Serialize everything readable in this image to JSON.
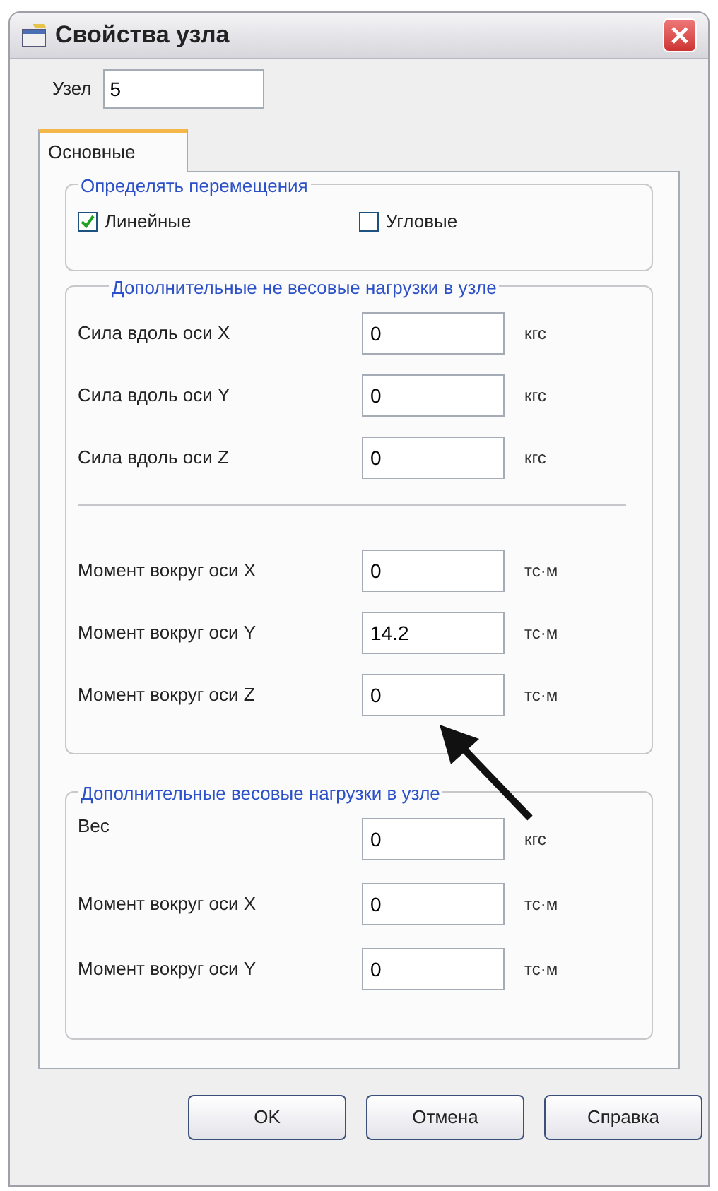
{
  "window": {
    "title": "Свойства узла"
  },
  "node": {
    "label": "Узел",
    "value": "5"
  },
  "tabs": [
    {
      "label": "Основные",
      "selected": true
    }
  ],
  "displacements": {
    "title": "Определять перемещения",
    "options": [
      {
        "label": "Линейные",
        "checked": true
      },
      {
        "label": "Угловые",
        "checked": false
      }
    ]
  },
  "non_weight_loads": {
    "title": "Дополнительные не весовые нагрузки в узле",
    "rows": [
      {
        "kind": "field",
        "label": "Сила вдоль оси X",
        "value": "0",
        "unit": "кгс"
      },
      {
        "kind": "field",
        "label": "Сила вдоль оси Y",
        "value": "0",
        "unit": "кгс"
      },
      {
        "kind": "field",
        "label": "Сила вдоль оси Z",
        "value": "0",
        "unit": "кгс"
      },
      {
        "kind": "separator"
      },
      {
        "kind": "field",
        "label": "Момент вокруг оси X",
        "value": "0",
        "unit": "тс·м"
      },
      {
        "kind": "field",
        "label": "Момент вокруг оси Y",
        "value": "14.2",
        "unit": "тс·м"
      },
      {
        "kind": "field",
        "label": "Момент вокруг оси Z",
        "value": "0",
        "unit": "тс·м"
      }
    ]
  },
  "weight_loads": {
    "title": "Дополнительные весовые нагрузки в узле",
    "rows": [
      {
        "kind": "field",
        "label": "Вес",
        "value": "0",
        "unit": "кгс"
      },
      {
        "kind": "field",
        "label": "Момент вокруг оси X",
        "value": "0",
        "unit": "тс·м"
      },
      {
        "kind": "field",
        "label": "Момент вокруг оси Y",
        "value": "0",
        "unit": "тс·м"
      }
    ]
  },
  "buttons": [
    "OK",
    "Отмена",
    "Справка"
  ]
}
